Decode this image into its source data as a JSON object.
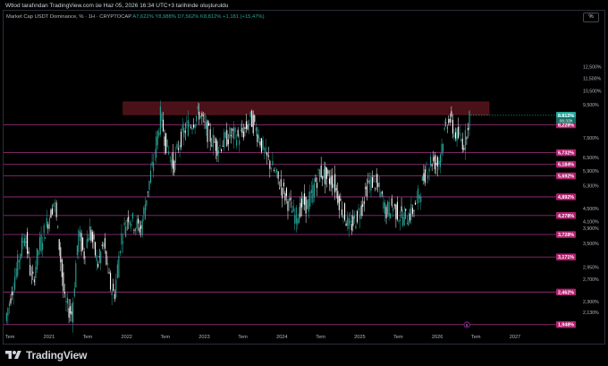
{
  "caption": "Wtlod tarafından TradingView.com üe Haz 05, 2026 16:34 UTC+3 tarihinde oluşturuldu",
  "symbol": {
    "name": "Market Cap USDT Dominance, % · 1H · CRYPTOCAP",
    "ohlc": "A7,622% Y8,988% D7,562% K8,812% +1,181 (+15,47%)"
  },
  "percent_button": "%",
  "brand": "TradingView",
  "colors": {
    "background": "#000000",
    "up": "#26a69a",
    "down": "#ffffff",
    "level_line": "#8e2a73",
    "tag_bg": "#b1206e",
    "zone": "#4a1119",
    "price_tag": "#26a69a"
  },
  "chart_data": {
    "type": "candlestick",
    "y_scale": "log",
    "ylim": [
      1.87,
      17.0
    ],
    "xlim": [
      "2020-06-01",
      "2027-07-01"
    ],
    "x_ticks": [
      {
        "date": "2020-07-01",
        "label": "Tem"
      },
      {
        "date": "2021-01-01",
        "label": "2021"
      },
      {
        "date": "2021-07-01",
        "label": "Tem"
      },
      {
        "date": "2022-01-01",
        "label": "2022"
      },
      {
        "date": "2022-07-01",
        "label": "Tem"
      },
      {
        "date": "2023-01-01",
        "label": "2023"
      },
      {
        "date": "2023-07-01",
        "label": "Tem"
      },
      {
        "date": "2024-01-01",
        "label": "2024"
      },
      {
        "date": "2024-07-01",
        "label": "Tem"
      },
      {
        "date": "2025-01-01",
        "label": "2025"
      },
      {
        "date": "2025-07-01",
        "label": "Tem"
      },
      {
        "date": "2026-01-01",
        "label": "2026"
      },
      {
        "date": "2026-07-01",
        "label": "Tem"
      },
      {
        "date": "2027-01-01",
        "label": "2027"
      },
      {
        "date": "2027-07-01",
        "label": "Tem"
      }
    ],
    "y_ticks": [
      {
        "value": 12.5,
        "label": "12,500%"
      },
      {
        "value": 11.5,
        "label": "11,500%"
      },
      {
        "value": 10.5,
        "label": "10,500%"
      },
      {
        "value": 9.5,
        "label": "9,500%"
      },
      {
        "value": 7.5,
        "label": "7,500%"
      },
      {
        "value": 6.5,
        "label": "6,500%"
      },
      {
        "value": 5.9,
        "label": "5,900%"
      },
      {
        "value": 5.3,
        "label": "5,300%"
      },
      {
        "value": 4.5,
        "label": "4,500%"
      },
      {
        "value": 4.1,
        "label": "4,100%"
      },
      {
        "value": 3.9,
        "label": "3,900%"
      },
      {
        "value": 3.5,
        "label": "3,500%"
      },
      {
        "value": 2.95,
        "label": "2,950%"
      },
      {
        "value": 2.7,
        "label": "2,700%"
      },
      {
        "value": 2.3,
        "label": "2,300%"
      },
      {
        "value": 2.13,
        "label": "2,130%"
      }
    ],
    "horizontal_levels": [
      {
        "value": 8.228,
        "label": "8,228%"
      },
      {
        "value": 6.732,
        "label": "6,732%"
      },
      {
        "value": 6.184,
        "label": "6,184%"
      },
      {
        "value": 5.692,
        "label": "5,692%"
      },
      {
        "value": 4.892,
        "label": "4,892%"
      },
      {
        "value": 4.278,
        "label": "4,278%"
      },
      {
        "value": 3.728,
        "label": "3,728%"
      },
      {
        "value": 3.171,
        "label": "3,171%"
      },
      {
        "value": 2.462,
        "label": "2,462%"
      },
      {
        "value": 1.948,
        "label": "1,948%"
      }
    ],
    "resistance_zone": {
      "from": 8.85,
      "to": 9.7,
      "x_start": "2021-12-15",
      "x_end": "2026-09-01"
    },
    "current_price": {
      "value": 8.812,
      "label": "8,812%"
    },
    "current_sub": {
      "value": 8.5,
      "label": "06:33h"
    },
    "markers": [
      {
        "date": "2026-05-20",
        "label": "8"
      }
    ],
    "series": [
      {
        "points": [
          [
            "2020-06-15",
            2.0
          ],
          [
            "2020-08-01",
            2.8
          ],
          [
            "2020-09-15",
            3.8
          ],
          [
            "2020-10-20",
            2.6
          ],
          [
            "2020-11-20",
            3.4
          ],
          [
            "2021-01-01",
            4.1
          ],
          [
            "2021-02-01",
            4.8
          ],
          [
            "2021-03-01",
            3.2
          ],
          [
            "2021-03-20",
            2.3
          ],
          [
            "2021-04-25",
            2.1
          ],
          [
            "2021-05-25",
            3.8
          ],
          [
            "2021-06-20",
            3.2
          ],
          [
            "2021-07-15",
            3.9
          ],
          [
            "2021-08-25",
            3.0
          ],
          [
            "2021-09-20",
            3.5
          ],
          [
            "2021-10-20",
            2.6
          ],
          [
            "2021-11-10",
            2.4
          ],
          [
            "2021-12-10",
            3.6
          ],
          [
            "2022-01-15",
            4.3
          ],
          [
            "2022-02-15",
            4.0
          ],
          [
            "2022-03-15",
            3.9
          ],
          [
            "2022-04-10",
            4.9
          ],
          [
            "2022-05-12",
            6.3
          ],
          [
            "2022-06-15",
            8.8
          ],
          [
            "2022-07-15",
            7.0
          ],
          [
            "2022-08-15",
            6.1
          ],
          [
            "2022-09-15",
            7.4
          ],
          [
            "2022-10-15",
            8.1
          ],
          [
            "2022-11-10",
            8.4
          ],
          [
            "2022-12-15",
            9.0
          ],
          [
            "2023-01-10",
            8.1
          ],
          [
            "2023-02-10",
            7.4
          ],
          [
            "2023-03-15",
            7.0
          ],
          [
            "2023-04-15",
            7.4
          ],
          [
            "2023-05-15",
            7.7
          ],
          [
            "2023-06-15",
            7.5
          ],
          [
            "2023-07-15",
            7.9
          ],
          [
            "2023-08-15",
            8.6
          ],
          [
            "2023-09-20",
            7.6
          ],
          [
            "2023-10-20",
            6.6
          ],
          [
            "2023-11-20",
            6.1
          ],
          [
            "2024-01-01",
            5.3
          ],
          [
            "2024-02-01",
            4.8
          ],
          [
            "2024-03-10",
            4.2
          ],
          [
            "2024-04-15",
            4.7
          ],
          [
            "2024-05-10",
            4.6
          ],
          [
            "2024-06-10",
            5.4
          ],
          [
            "2024-07-05",
            5.9
          ],
          [
            "2024-08-05",
            5.6
          ],
          [
            "2024-09-05",
            5.5
          ],
          [
            "2024-10-10",
            4.6
          ],
          [
            "2024-11-20",
            3.9
          ],
          [
            "2024-12-20",
            4.2
          ],
          [
            "2025-01-15",
            4.6
          ],
          [
            "2025-02-15",
            5.4
          ],
          [
            "2025-03-15",
            5.5
          ],
          [
            "2025-04-10",
            5.1
          ],
          [
            "2025-05-10",
            4.4
          ],
          [
            "2025-06-10",
            4.6
          ],
          [
            "2025-07-10",
            4.3
          ],
          [
            "2025-08-10",
            4.2
          ],
          [
            "2025-09-10",
            4.4
          ],
          [
            "2025-10-10",
            4.9
          ],
          [
            "2025-11-10",
            5.8
          ],
          [
            "2025-12-10",
            6.4
          ],
          [
            "2026-01-10",
            6.2
          ],
          [
            "2026-02-05",
            7.6
          ],
          [
            "2026-03-01",
            8.8
          ],
          [
            "2026-03-25",
            7.8
          ],
          [
            "2026-04-20",
            7.5
          ],
          [
            "2026-05-15",
            7.2
          ],
          [
            "2026-06-05",
            8.81
          ]
        ]
      }
    ]
  }
}
